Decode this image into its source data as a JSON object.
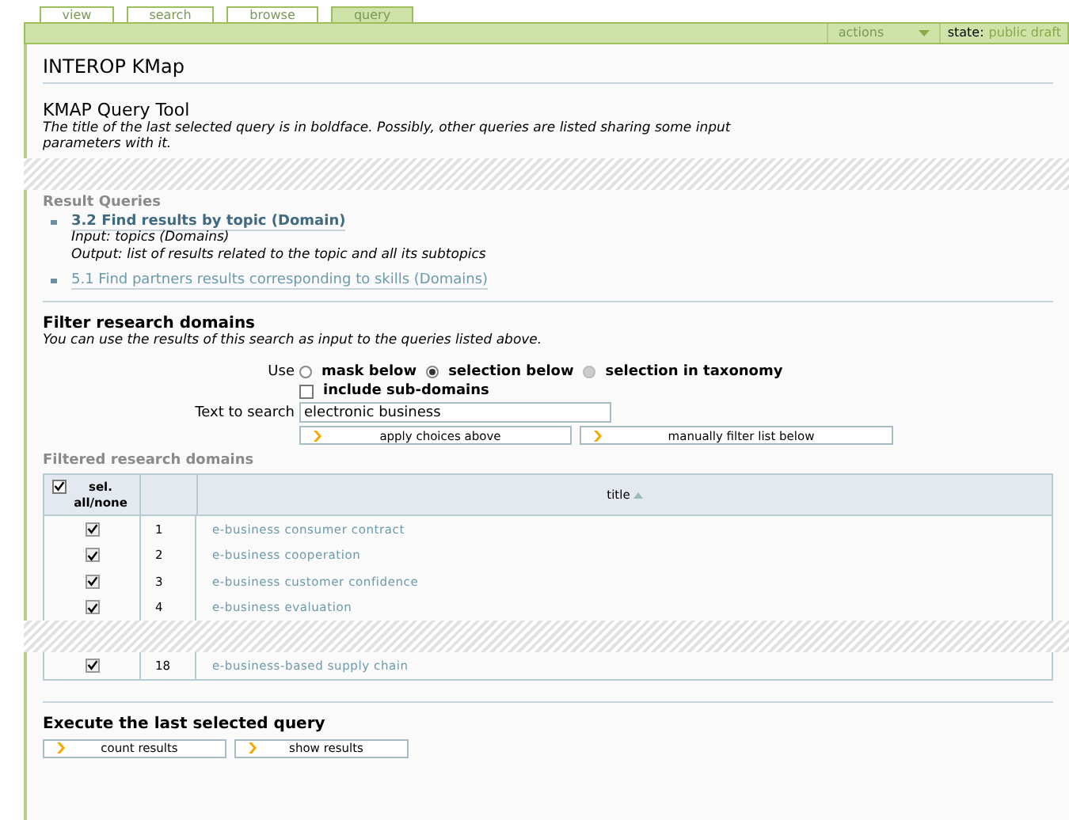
{
  "tabs": [
    {
      "label": "view",
      "selected": false
    },
    {
      "label": "search",
      "selected": false
    },
    {
      "label": "browse",
      "selected": false
    },
    {
      "label": "query",
      "selected": true
    }
  ],
  "toolbar": {
    "actions": "actions",
    "state_label": "state:",
    "state_value": "public draft"
  },
  "title": "INTEROP KMap",
  "tool": {
    "heading": "KMAP Query Tool",
    "description": "The title of the last selected query is in boldface. Possibly, other queries are listed sharing some input parameters with it."
  },
  "result_queries": {
    "heading": "Result Queries",
    "items": [
      {
        "title": "3.2 Find results by topic (Domain)",
        "selected": true,
        "details": [
          "Input: topics (Domains)",
          "Output: list of results related to the topic and all its subtopics"
        ]
      },
      {
        "title": "5.1 Find partners results corresponding to skills (Domains)",
        "selected": false
      }
    ]
  },
  "filter": {
    "heading": "Filter research domains",
    "description": "You can use the results of this search as input to the queries listed above.",
    "use_label": "Use",
    "options": [
      {
        "label": "mask below",
        "selected": false,
        "disabled": false
      },
      {
        "label": "selection below",
        "selected": true,
        "disabled": false
      },
      {
        "label": "selection in taxonomy",
        "selected": false,
        "disabled": true
      }
    ],
    "include_subdomains": {
      "label": "include sub-domains",
      "checked": false
    },
    "search": {
      "label": "Text to search",
      "value": "electronic business"
    },
    "buttons": [
      "apply choices above",
      "manually filter list below"
    ]
  },
  "filtered": {
    "heading": "Filtered research domains",
    "select_all": {
      "label": "sel. all/none",
      "checked": true
    },
    "title_column": "title",
    "sort_ascending": true,
    "row_groups": [
      [
        {
          "checked": true,
          "number": "1",
          "title": "e-business consumer contract"
        },
        {
          "checked": true,
          "number": "2",
          "title": "e-business cooperation"
        },
        {
          "checked": true,
          "number": "3",
          "title": "e-business customer confidence"
        },
        {
          "checked": true,
          "number": "4",
          "title": "e-business evaluation"
        }
      ],
      [
        {
          "checked": true,
          "number": "18",
          "title": "e-business-based supply chain"
        }
      ]
    ]
  },
  "execute": {
    "heading": "Execute the last selected query",
    "buttons": [
      "count results",
      "show results"
    ]
  }
}
